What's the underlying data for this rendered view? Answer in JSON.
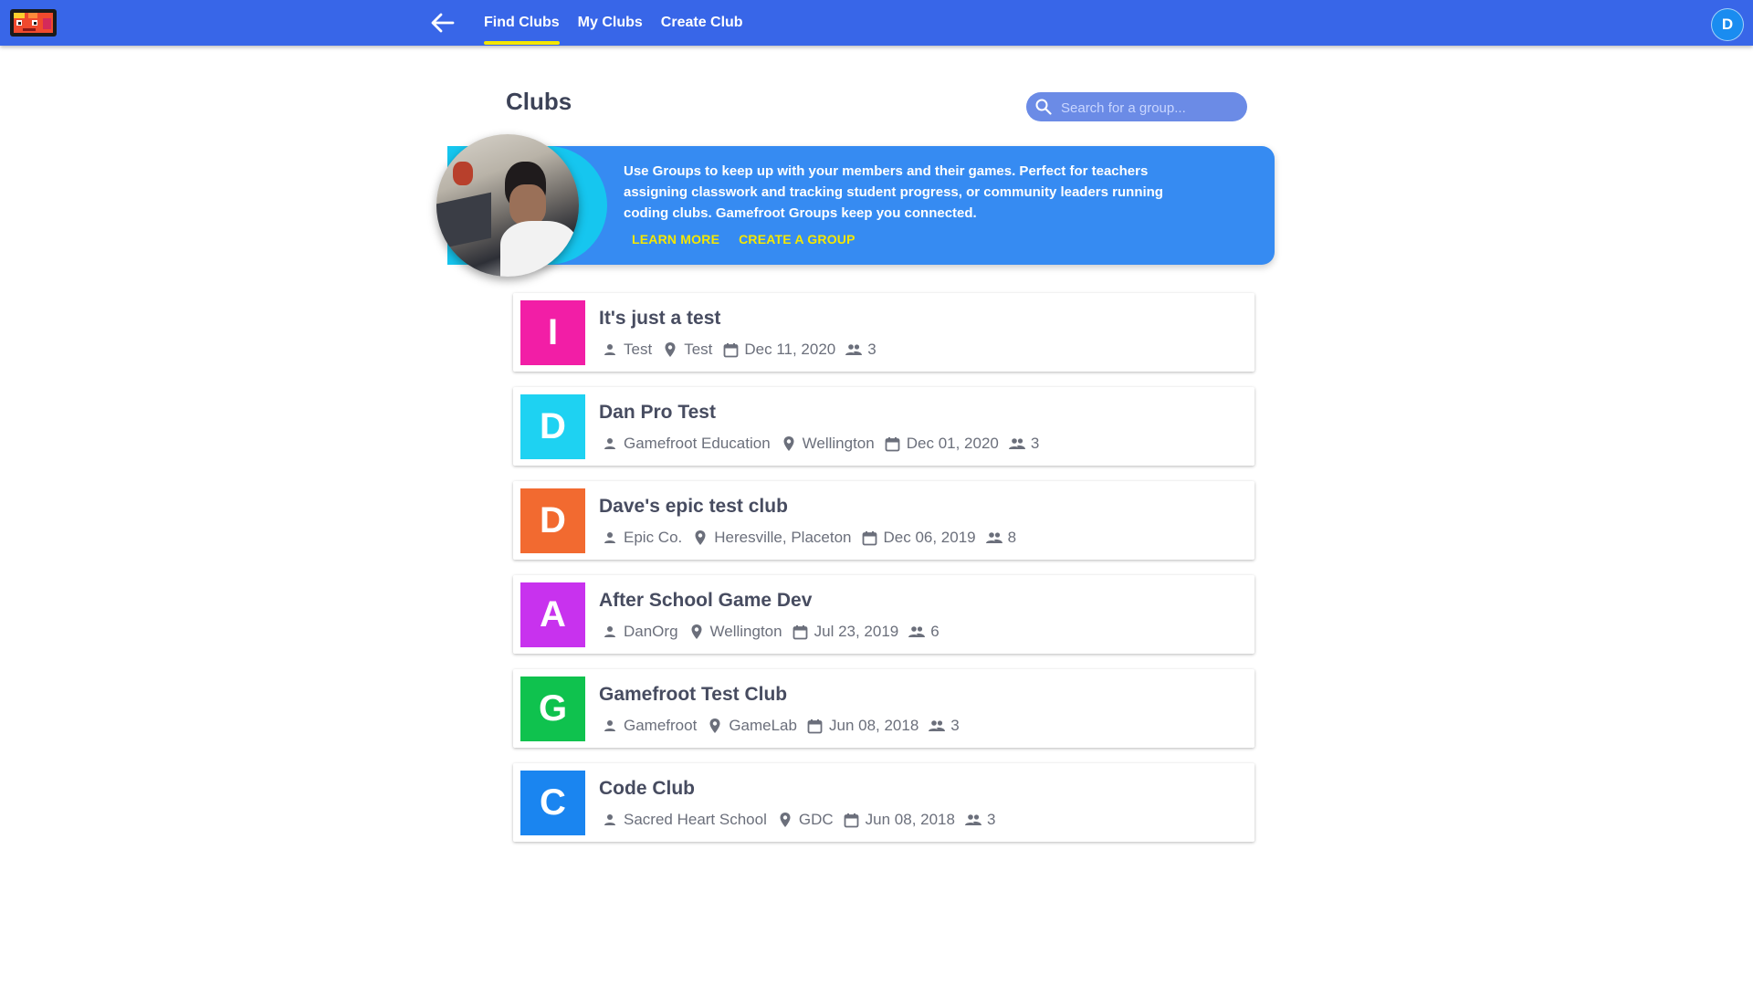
{
  "header": {
    "tabs": [
      {
        "label": "Find Clubs",
        "active": true
      },
      {
        "label": "My Clubs",
        "active": false
      },
      {
        "label": "Create Club",
        "active": false
      }
    ],
    "avatar_initial": "D"
  },
  "page": {
    "title": "Clubs",
    "search_placeholder": "Search for a group..."
  },
  "banner": {
    "text": "Use Groups to keep up with your members and their games. Perfect for teachers assigning classwork and tracking student progress, or community leaders running coding clubs. Gamefroot Groups keep you connected.",
    "learn_more": "LEARN MORE",
    "create_group": "CREATE A GROUP"
  },
  "clubs": [
    {
      "letter": "I",
      "color": "#f21ea6",
      "name": "It's just a test",
      "owner": "Test",
      "location": "Test",
      "date": "Dec 11, 2020",
      "members": "3"
    },
    {
      "letter": "D",
      "color": "#1ed2f2",
      "name": "Dan Pro Test",
      "owner": "Gamefroot Education",
      "location": "Wellington",
      "date": "Dec 01, 2020",
      "members": "3"
    },
    {
      "letter": "D",
      "color": "#f26a30",
      "name": "Dave's epic test club",
      "owner": "Epic Co.",
      "location": "Heresville, Placeton",
      "date": "Dec 06, 2019",
      "members": "8"
    },
    {
      "letter": "A",
      "color": "#c832ee",
      "name": "After School Game Dev",
      "owner": "DanOrg",
      "location": "Wellington",
      "date": "Jul 23, 2019",
      "members": "6"
    },
    {
      "letter": "G",
      "color": "#0fc24e",
      "name": "Gamefroot Test Club",
      "owner": "Gamefroot",
      "location": "GameLab",
      "date": "Jun 08, 2018",
      "members": "3"
    },
    {
      "letter": "C",
      "color": "#1a85f0",
      "name": "Code Club",
      "owner": "Sacred Heart School",
      "location": "GDC",
      "date": "Jun 08, 2018",
      "members": "3"
    }
  ],
  "colors": {
    "topbar": "#3866e8",
    "active_underline": "#f5e700",
    "banner": "#368bf2",
    "link": "#f5e700"
  },
  "icons": {
    "owner": "person-icon",
    "location": "location-pin-icon",
    "date": "calendar-icon",
    "members": "people-icon"
  }
}
